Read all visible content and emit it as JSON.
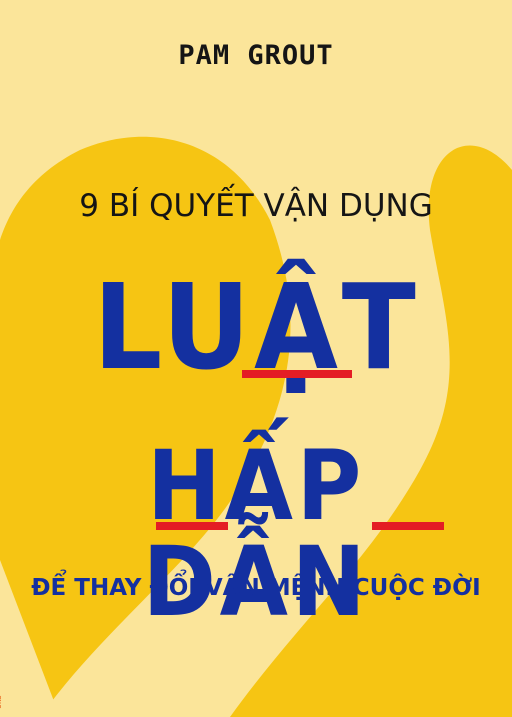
{
  "cover": {
    "author": "PAM GROUT",
    "subtitle": "9 BÍ QUYẾT VẬN DỤNG",
    "title_line1": "LUẬT",
    "title_line2": "HẤP DẪN",
    "tagline": "ĐỂ THAY ĐỔI VẬN MỆNH CUỘC ĐỜI",
    "publisher_mark": "oks"
  },
  "colors": {
    "background": "#f6c513",
    "pale_shape": "#fbe59a",
    "title_blue": "#1430a0",
    "magnet_red": "#e41d24",
    "text_dark": "#151515"
  }
}
